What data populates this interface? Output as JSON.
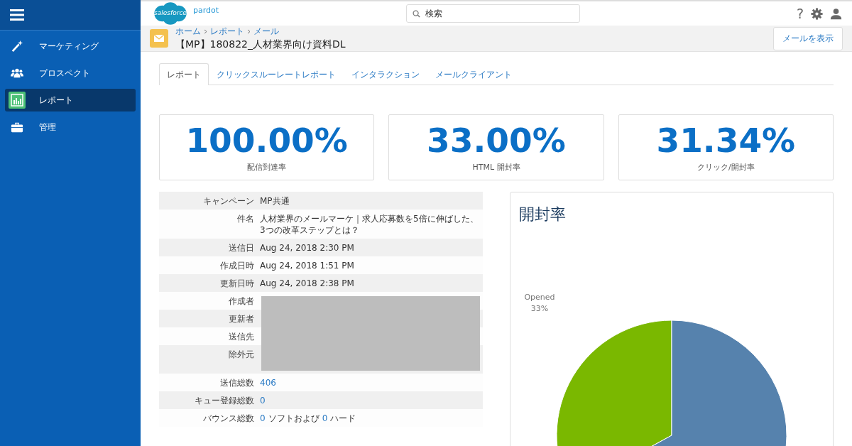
{
  "logo": {
    "cloud_text": "salesforce",
    "product": "pardot"
  },
  "search": {
    "placeholder": "検索"
  },
  "header_actions": {
    "help": "?"
  },
  "sidebar": {
    "items": [
      {
        "label": "マーケティング",
        "kind": "wand",
        "selected": false
      },
      {
        "label": "プロスペクト",
        "kind": "people",
        "selected": false
      },
      {
        "label": "レポート",
        "kind": "report",
        "selected": true
      },
      {
        "label": "管理",
        "kind": "briefcase",
        "selected": false
      }
    ]
  },
  "breadcrumb": [
    "ホーム",
    "レポート",
    "メール"
  ],
  "page_title": "【MP】180822_人材業界向け資料DL",
  "view_button": "メールを表示",
  "tabs": [
    {
      "label": "レポート",
      "selected": true
    },
    {
      "label": "クリックスルーレートレポート",
      "selected": false
    },
    {
      "label": "インタラクション",
      "selected": false
    },
    {
      "label": "メールクライアント",
      "selected": false
    }
  ],
  "stats": [
    {
      "value": "100.00%",
      "label": "配信到達率"
    },
    {
      "value": "33.00%",
      "label": "HTML 開封率"
    },
    {
      "value": "31.34%",
      "label": "クリック/開封率"
    }
  ],
  "details": [
    {
      "label": "キャンペーン",
      "parts": [
        {
          "text": "MP共通",
          "link": false
        }
      ],
      "redacted": false
    },
    {
      "label": "件名",
      "parts": [
        {
          "text": "人材業界のメールマーケ｜求人応募数を5倍に伸ばした、3つの改革ステップとは？",
          "link": false
        }
      ],
      "redacted": false
    },
    {
      "label": "送信日",
      "parts": [
        {
          "text": "Aug 24, 2018 2:30 PM",
          "link": false
        }
      ],
      "redacted": false
    },
    {
      "label": "作成日時",
      "parts": [
        {
          "text": "Aug 24, 2018 1:51 PM",
          "link": false
        }
      ],
      "redacted": false
    },
    {
      "label": "更新日時",
      "parts": [
        {
          "text": "Aug 24, 2018 2:38 PM",
          "link": false
        }
      ],
      "redacted": false
    },
    {
      "label": "作成者",
      "redacted": true
    },
    {
      "label": "更新者",
      "redacted": true
    },
    {
      "label": "送信先",
      "redacted": true
    },
    {
      "label": "除外元",
      "redacted": true
    },
    {
      "label": "送信総数",
      "parts": [
        {
          "text": "406",
          "link": true
        }
      ],
      "redacted": false
    },
    {
      "label": "キュー登録総数",
      "parts": [
        {
          "text": "0",
          "link": true
        }
      ],
      "redacted": false
    },
    {
      "label": "バウンス総数",
      "parts": [
        {
          "text": "0",
          "link": true
        },
        {
          "text": "ソフトおよび",
          "link": false
        },
        {
          "text": "0",
          "link": true
        },
        {
          "text": "ハード",
          "link": false
        }
      ],
      "redacted": false
    }
  ],
  "chart_panel": {
    "title": "開封率",
    "chart_data": {
      "type": "pie",
      "categories": [
        "Opened",
        null
      ],
      "series": [
        {
          "values": [
            33,
            67
          ]
        }
      ],
      "colors": [
        "#7ab800",
        "#5682ad"
      ],
      "value_labels": [
        "33%",
        null
      ]
    }
  }
}
